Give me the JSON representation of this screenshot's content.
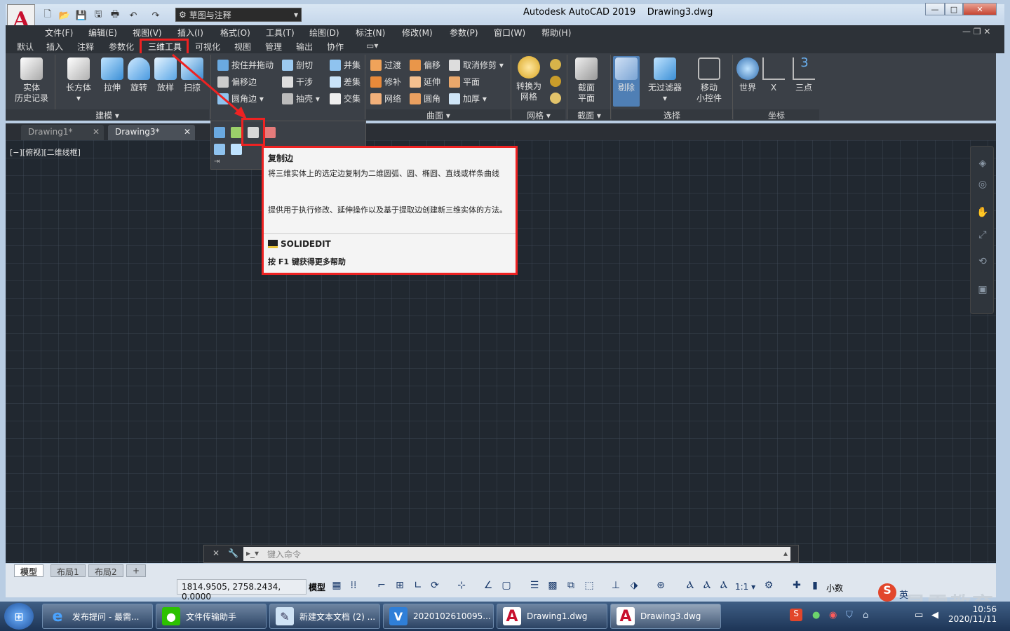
{
  "titlebar": {
    "app_title": "Autodesk AutoCAD 2019",
    "doc_title": "Drawing3.dwg",
    "logo": "A",
    "workspace": "草图与注释"
  },
  "menu": [
    "文件(F)",
    "编辑(E)",
    "视图(V)",
    "插入(I)",
    "格式(O)",
    "工具(T)",
    "绘图(D)",
    "标注(N)",
    "修改(M)",
    "参数(P)",
    "窗口(W)",
    "帮助(H)"
  ],
  "ribbon_tabs": [
    "默认",
    "插入",
    "注释",
    "参数化",
    "三维工具",
    "可视化",
    "视图",
    "管理",
    "输出",
    "协作"
  ],
  "active_ribbon_tab": "三维工具",
  "ribbon": {
    "modeling": {
      "label": "建模 ▾",
      "buttons": [
        "实体\n历史记录",
        "长方体",
        "拉伸",
        "旋转",
        "放样",
        "扫掠"
      ]
    },
    "solid_edit": {
      "col1": [
        "按住并拖动",
        "偏移边",
        "圆角边 ▾"
      ],
      "col2": [
        "剖切",
        "干涉",
        "抽壳 ▾"
      ],
      "col3": [
        "并集",
        "差集",
        "交集"
      ]
    },
    "surface": {
      "label": "曲面 ▾",
      "col1": [
        "过渡",
        "修补",
        "网络"
      ],
      "col2": [
        "偏移",
        "延伸",
        "圆角"
      ],
      "col3": [
        "取消修剪 ▾",
        "平面",
        "加厚 ▾"
      ]
    },
    "mesh": {
      "label": "网格 ▾",
      "button": "转换为\n网格"
    },
    "section": {
      "label": "截面 ▾",
      "button": "截面\n平面"
    },
    "selection": {
      "label": "选择",
      "buttons": [
        "剔除",
        "无过滤器",
        "移动\n小控件"
      ]
    },
    "coords": {
      "label": "坐标",
      "buttons": [
        "世界",
        "X",
        "三点"
      ]
    }
  },
  "doc_tabs": [
    "Drawing1*",
    "Drawing3*"
  ],
  "viewport_label": "[−][俯视][二维线框]",
  "tooltip": {
    "title": "复制边",
    "desc1": "将三维实体上的选定边复制为二维圆弧、圆、椭圆、直线或样条曲线",
    "desc2": "提供用于执行修改、延伸操作以及基于提取边创建新三维实体的方法。",
    "command": "SOLIDEDIT",
    "help": "按 F1 键获得更多帮助"
  },
  "command_line": {
    "placeholder": "键入命令"
  },
  "layout_tabs": [
    "模型",
    "布局1",
    "布局2",
    "+"
  ],
  "status": {
    "coords": "1814.9505, 2758.2434, 0.0000",
    "model": "模型",
    "scale": "1:1 ▾",
    "units": "小数"
  },
  "taskbar": {
    "items": [
      "发布提问 - 最需...",
      "文件传输助手",
      "新建文本文档 (2) ...",
      "2020102610095...",
      "Drawing1.dwg",
      "Drawing3.dwg"
    ],
    "time": "10:56",
    "date": "2020/11/11",
    "ime": "英"
  },
  "watermark": "最需教育",
  "colors": {
    "accent_red": "#e22222",
    "ribbon_bg": "#3b4047",
    "canvas_bg": "#212830",
    "autocad_red": "#c8102e"
  }
}
